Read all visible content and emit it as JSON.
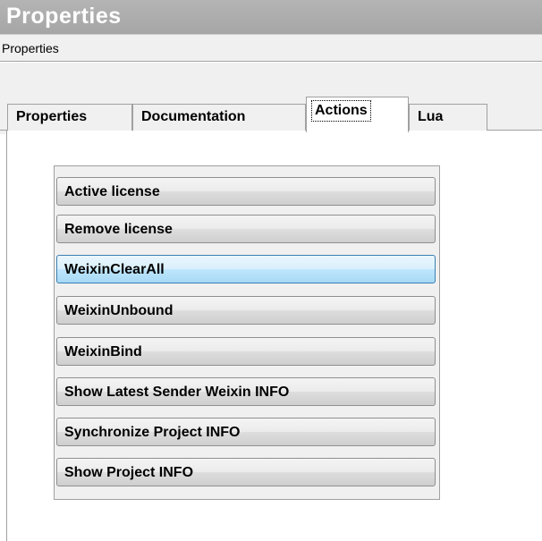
{
  "window": {
    "title": "Properties",
    "subtitle": "Properties"
  },
  "tabs": [
    {
      "label": "Properties",
      "active": false
    },
    {
      "label": "Documentation",
      "active": false
    },
    {
      "label": "Actions",
      "active": true
    },
    {
      "label": "Lua",
      "active": false
    }
  ],
  "actions": [
    {
      "label": "Active license"
    },
    {
      "label": "Remove license"
    },
    {
      "label": "WeixinClearAll",
      "hovered": true
    },
    {
      "label": "WeixinUnbound"
    },
    {
      "label": "WeixinBind"
    },
    {
      "label": "Show Latest Sender Weixin INFO"
    },
    {
      "label": "Synchronize Project INFO"
    },
    {
      "label": "Show Project INFO"
    }
  ],
  "colors": {
    "title_bar": "#a6a6a6",
    "hover_border": "#3c7fb1",
    "hover_fill": "#bee6fd"
  }
}
